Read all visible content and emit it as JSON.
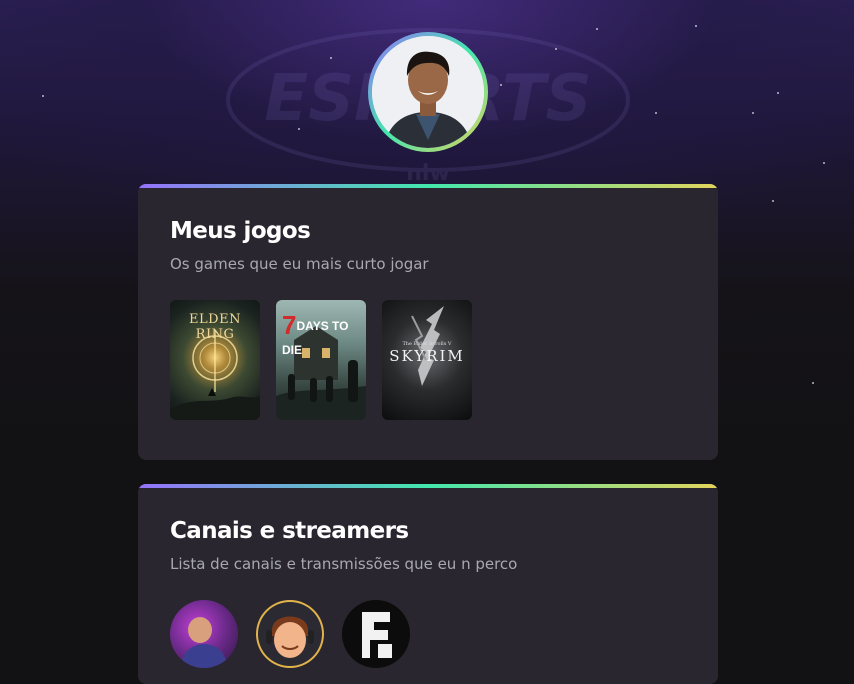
{
  "background": {
    "logo_text": "ESPORTS",
    "logo_subtext": "nlw"
  },
  "profile": {
    "avatar_alt": "Foto de perfil"
  },
  "games_section": {
    "title": "Meus jogos",
    "subtitle": "Os games que eu mais curto jogar",
    "games": [
      {
        "name": "ELDEN RING",
        "line1": "ELDEN RING",
        "line2": ""
      },
      {
        "name": "7 DAYS TO DIE",
        "line1": "7",
        "line2": "DAYS TO DIE"
      },
      {
        "name": "SKYRIM",
        "line1": "The Elder Scrolls V",
        "line2": "SKYRIM"
      }
    ]
  },
  "streamers_section": {
    "title": "Canais e streamers",
    "subtitle": "Lista de canais e transmissões que eu n perco",
    "streamers": [
      {
        "name": "streamer-1"
      },
      {
        "name": "streamer-2"
      },
      {
        "name": "streamer-3"
      }
    ]
  },
  "colors": {
    "page_background": "#121214",
    "card_background": "#29262f",
    "accent_gradient": [
      "#9572fc",
      "#43e7ad",
      "#e2d45c"
    ],
    "heading": "#ffffff",
    "subtitle": "#a8a8b3"
  }
}
